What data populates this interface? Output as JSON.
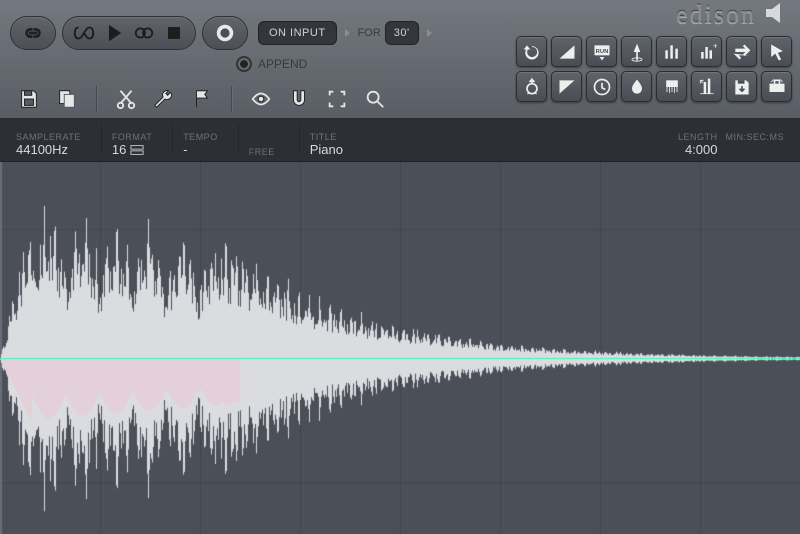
{
  "app": {
    "name": "edison"
  },
  "transport": {
    "record_mode": "ON INPUT",
    "for_label": "FOR",
    "duration": "30'",
    "append_label": "APPEND"
  },
  "info": {
    "samplerate_label": "SAMPLERATE",
    "samplerate_value": "44100Hz",
    "format_label": "FORMAT",
    "format_value": "16",
    "tempo_label": "TEMPO",
    "tempo_value": "-",
    "free_label": "FREE",
    "free_value": "",
    "title_label": "TITLE",
    "title_value": "Piano",
    "length_label": "LENGTH",
    "length_value": "4:000",
    "minsec_label": "MIN:SEC:MS"
  },
  "tool_grid": {
    "row1": [
      "undo",
      "fade",
      "script-run",
      "boost",
      "eq",
      "declip",
      "swap",
      "arrow"
    ],
    "row2": [
      "compass",
      "fade-out",
      "clock",
      "drop",
      "brush",
      "crop",
      "disk-load",
      "extend"
    ]
  },
  "row2_tools": [
    "save",
    "copy",
    "cut",
    "wrench",
    "flag",
    "eye",
    "magnet",
    "select-region",
    "zoom"
  ]
}
